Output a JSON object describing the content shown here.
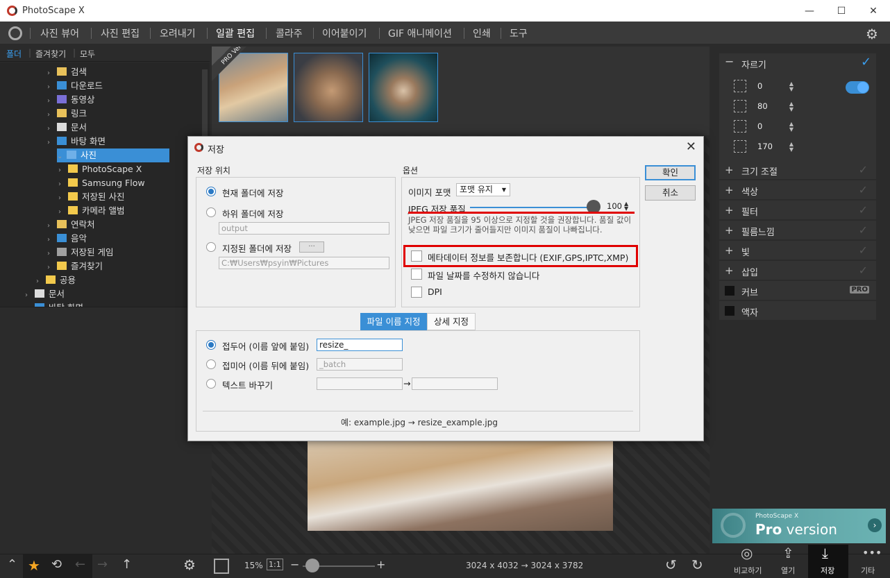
{
  "app": {
    "title": "PhotoScape X",
    "window_controls": [
      "—",
      "☐",
      "✕"
    ]
  },
  "menu": {
    "items": [
      "사진 뷰어",
      "사진 편집",
      "오려내기",
      "일괄 편집",
      "콜라주",
      "이어붙이기",
      "GIF 애니메이션",
      "인쇄",
      "도구"
    ],
    "active": "일괄 편집"
  },
  "left": {
    "tabs": [
      "폴더",
      "즐겨찾기",
      "모두"
    ],
    "tree": [
      {
        "label": "검색",
        "indent": 2,
        "icon": "search-folder"
      },
      {
        "label": "다운로드",
        "indent": 2,
        "icon": "download"
      },
      {
        "label": "동영상",
        "indent": 2,
        "icon": "video"
      },
      {
        "label": "링크",
        "indent": 2,
        "icon": "link"
      },
      {
        "label": "문서",
        "indent": 2,
        "icon": "document"
      },
      {
        "label": "바탕 화면",
        "indent": 2,
        "icon": "desktop"
      },
      {
        "label": "사진",
        "indent": 2,
        "icon": "pictures",
        "selected": true
      },
      {
        "label": "PhotoScape X",
        "indent": 3,
        "icon": "folder"
      },
      {
        "label": "Samsung Flow",
        "indent": 3,
        "icon": "folder"
      },
      {
        "label": "저장된 사진",
        "indent": 3,
        "icon": "folder"
      },
      {
        "label": "카메라 앨범",
        "indent": 3,
        "icon": "folder"
      },
      {
        "label": "연락처",
        "indent": 2,
        "icon": "contacts"
      },
      {
        "label": "음악",
        "indent": 2,
        "icon": "music"
      },
      {
        "label": "저장된 게임",
        "indent": 2,
        "icon": "games"
      },
      {
        "label": "즐겨찾기",
        "indent": 2,
        "icon": "favorites"
      },
      {
        "label": "공용",
        "indent": 1,
        "icon": "folder"
      },
      {
        "label": "문서",
        "indent": 0,
        "icon": "document"
      },
      {
        "label": "바탕 화면",
        "indent": 0,
        "icon": "desktop"
      }
    ]
  },
  "strip": {
    "pro_badge": "PRO Version"
  },
  "right": {
    "crop": {
      "label": "자르기",
      "values": [
        "0",
        "80",
        "0",
        "170"
      ]
    },
    "rows": [
      {
        "label": "크기 조절",
        "type": "plus"
      },
      {
        "label": "색상",
        "type": "plus"
      },
      {
        "label": "필터",
        "type": "plus"
      },
      {
        "label": "필름느낌",
        "type": "plus"
      },
      {
        "label": "빛",
        "type": "plus"
      },
      {
        "label": "삽입",
        "type": "plus"
      },
      {
        "label": "커브",
        "type": "box",
        "badge": "PRO"
      },
      {
        "label": "액자",
        "type": "box"
      }
    ],
    "banner": {
      "small": "PhotoScape X",
      "pro": "Pro",
      "version": " version"
    }
  },
  "bottom": {
    "zoom": "15%",
    "one_to_one": "1:1",
    "dimensions": "3024 x 4032 → 3024 x 3782",
    "actions": [
      "비교하기",
      "열기",
      "저장",
      "기타"
    ]
  },
  "dialog": {
    "title": "저장",
    "ok": "확인",
    "cancel": "취소",
    "save_location": {
      "label": "저장 위치",
      "options": [
        "현재 폴더에 저장",
        "하위 폴더에 저장",
        "지정된 폴더에 저장"
      ],
      "subfolder_placeholder": "output",
      "browse": "···",
      "path": "C:₩Users₩psyin₩Pictures"
    },
    "options": {
      "label": "옵션",
      "format_label": "이미지 포맷",
      "format_value": "포맷 유지",
      "jpeg_label": "JPEG 저장 품질",
      "jpeg_value": "100",
      "jpeg_fraction": 1.0,
      "hint": "JPEG 저장 품질을 95 이상으로 지정할 것을 권장합니다. 품질 값이 낮으면 파일 크기가 줄어들지만 이미지 품질이 나빠집니다.",
      "checks": [
        "메타데이터 정보를 보존합니다 (EXIF,GPS,IPTC,XMP)",
        "파일 날짜를 수정하지 않습니다",
        "DPI"
      ]
    },
    "tabs": [
      "파일 이름 지정",
      "상세 지정"
    ],
    "naming": {
      "options": [
        "접두어 (이름 앞에 붙임)",
        "접미어 (이름 뒤에 붙임)",
        "텍스트 바꾸기"
      ],
      "prefix": "resize_",
      "suffix": "_batch",
      "arrow": "→",
      "example": "예: example.jpg → resize_example.jpg"
    }
  }
}
